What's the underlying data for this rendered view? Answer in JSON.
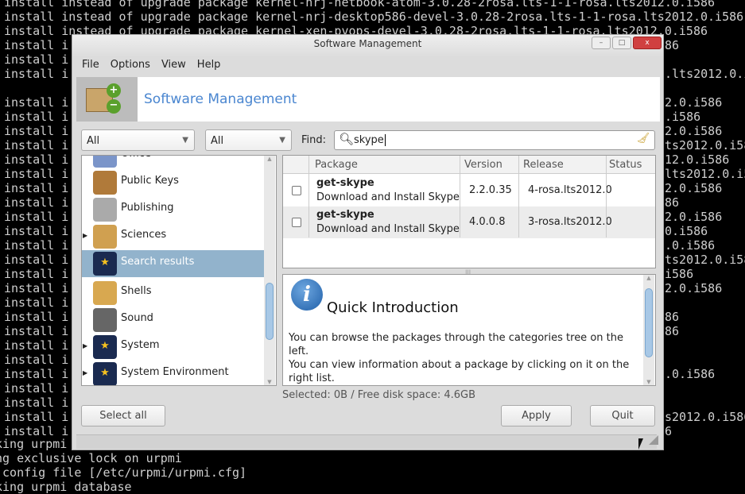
{
  "terminal": {
    "full_lines": [
      "install instead of upgrade package kernel-nrj-netbook-atom-3.0.28-2rosa.lts-1-1-rosa.lts2012.0.i586",
      "install instead of upgrade package kernel-nrj-desktop586-devel-3.0.28-2rosa.lts-1-1-rosa.lts2012.0.i586",
      "install instead of upgrade package kernel-xen-pvops-devel-3.0.28-2rosa.lts-1-1-rosa.lts2012.0.i586"
    ],
    "left_prefix": "install i",
    "right_fragments": [
      "86",
      "",
      ".lts2012.0.i586",
      "",
      "2.0.i586",
      ".i586",
      "2.0.i586",
      "ts2012.0.i586",
      "12.0.i586",
      "lts2012.0.i586",
      "2.0.i586",
      "86",
      "2.0.i586",
      "0.i586",
      ".0.i586",
      "ts2012.0.i586",
      "i586",
      "2.0.i586",
      "",
      "86",
      "86",
      "",
      "",
      ".0.i586",
      "",
      "",
      "s2012.0.i586",
      "6"
    ],
    "bottom_lines": [
      "king urpmi",
      "ng exclusive lock on urpmi",
      " config file [/etc/urpmi/urpmi.cfg]",
      "king urpmi database"
    ]
  },
  "window": {
    "title": "Software Management",
    "minimize": "–",
    "maximize": "□",
    "close": "x"
  },
  "menu": [
    "File",
    "Options",
    "View",
    "Help"
  ],
  "banner": {
    "title": "Software Management"
  },
  "filters": {
    "first": "All",
    "second": "All",
    "find_label": "Find:",
    "find_value": "skype"
  },
  "tree": [
    {
      "label": "Office",
      "expander": false,
      "icon": "office-icon"
    },
    {
      "label": "Public Keys",
      "expander": false,
      "icon": "public-keys-icon"
    },
    {
      "label": "Publishing",
      "expander": false,
      "icon": "publishing-icon"
    },
    {
      "label": "Sciences",
      "expander": true,
      "icon": "sciences-icon"
    },
    {
      "label": "Search results",
      "expander": false,
      "icon": "monitor-star-icon",
      "selected": true
    },
    {
      "label": "Shells",
      "expander": false,
      "icon": "shell-icon"
    },
    {
      "label": "Sound",
      "expander": false,
      "icon": "speaker-icon"
    },
    {
      "label": "System",
      "expander": true,
      "icon": "monitor-star-icon"
    },
    {
      "label": "System Environment",
      "expander": true,
      "icon": "monitor-star-icon"
    }
  ],
  "table": {
    "headers": [
      "Package",
      "Version",
      "Release",
      "Status"
    ],
    "rows": [
      {
        "name": "get-skype",
        "desc": "Download and Install Skype",
        "version": "2.2.0.35",
        "release": "4-rosa.lts2012.0",
        "status": ""
      },
      {
        "name": "get-skype",
        "desc": "Download and Install Skype",
        "version": "4.0.0.8",
        "release": "3-rosa.lts2012.0",
        "status": ""
      }
    ]
  },
  "info": {
    "title": "Quick Introduction",
    "p1": "You can browse the packages through the categories tree on the left.",
    "p2": "You can view information about a package by clicking on it on the right list."
  },
  "status": "Selected: 0B / Free disk space: 4.6GB",
  "buttons": {
    "select_all": "Select all",
    "apply": "Apply",
    "quit": "Quit"
  }
}
